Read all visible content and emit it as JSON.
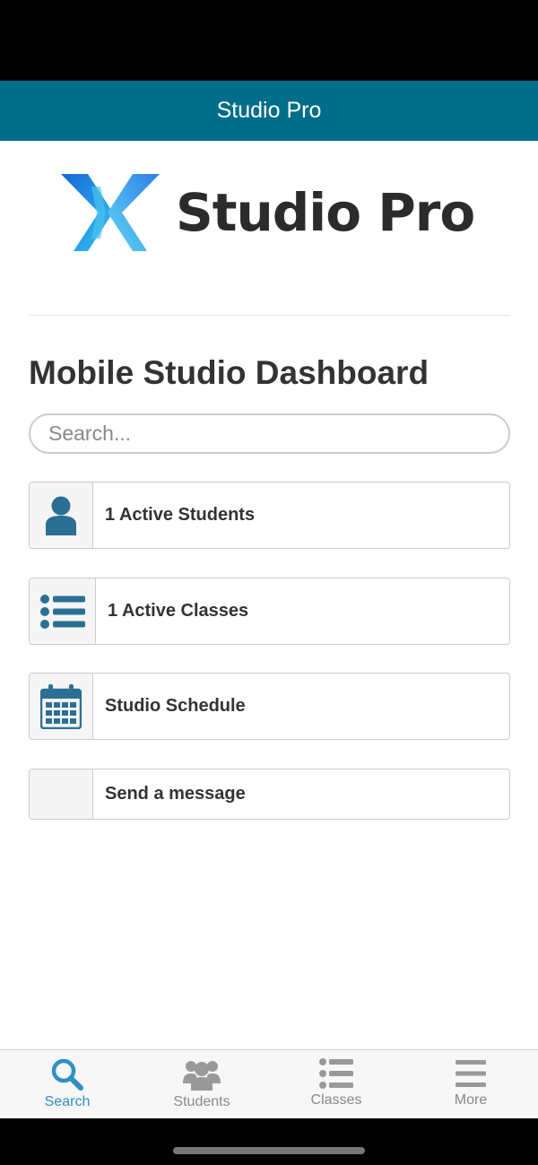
{
  "navbar": {
    "title": "Studio Pro"
  },
  "logo": {
    "text": "Studio Pro"
  },
  "page": {
    "title": "Mobile Studio Dashboard"
  },
  "search": {
    "placeholder": "Search..."
  },
  "cards": [
    {
      "label": "1 Active Students",
      "icon": "user-icon"
    },
    {
      "label": "1 Active Classes",
      "icon": "list-icon"
    },
    {
      "label": "Studio Schedule",
      "icon": "calendar-icon"
    },
    {
      "label": "Send a message",
      "icon": ""
    }
  ],
  "tabs": [
    {
      "label": "Search",
      "icon": "search-icon",
      "active": true
    },
    {
      "label": "Students",
      "icon": "users-icon",
      "active": false
    },
    {
      "label": "Classes",
      "icon": "list-icon",
      "active": false
    },
    {
      "label": "More",
      "icon": "menu-icon",
      "active": false
    }
  ],
  "colors": {
    "navbar": "#006d8a",
    "accent": "#2f8fc6",
    "icon": "#2b6f95"
  }
}
